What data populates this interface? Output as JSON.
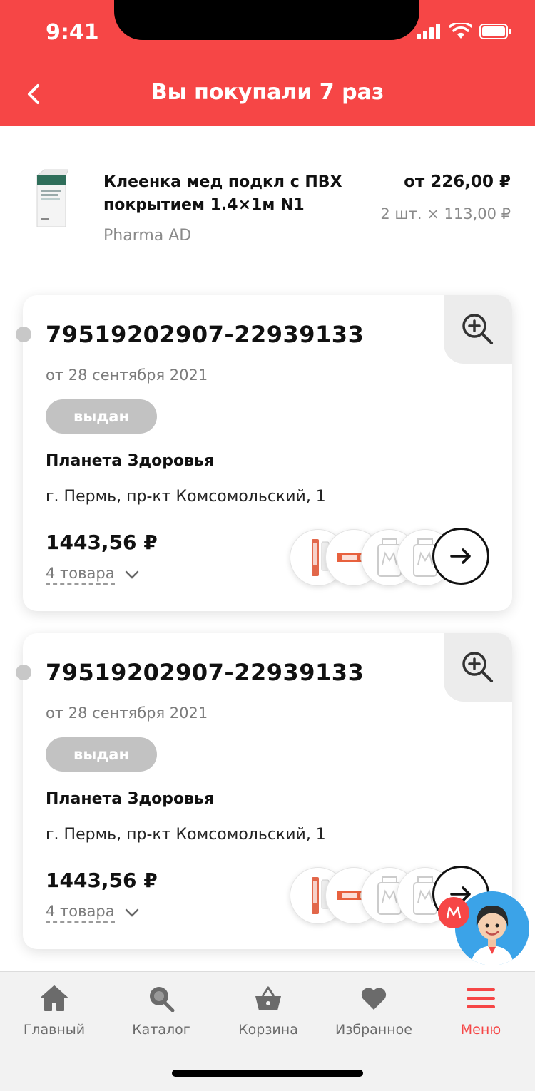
{
  "status_bar": {
    "time": "9:41"
  },
  "header": {
    "title": "Вы покупали 7 раз"
  },
  "product": {
    "name": "Клеенка мед подкл с ПВХ покрытием 1.4×1м N1",
    "brand": "Pharma AD",
    "price": "от 226,00 ₽",
    "quantity": "2 шт. × 113,00 ₽"
  },
  "orders": [
    {
      "number": "79519202907-22939133",
      "date": "от 28 сентября 2021",
      "status": "выдан",
      "store": "Планета Здоровья",
      "address": "г. Пермь, пр-кт Комсомольский, 1",
      "total": "1443,56 ₽",
      "items_count": "4 товара"
    },
    {
      "number": "79519202907-22939133",
      "date": "от 28 сентября 2021",
      "status": "выдан",
      "store": "Планета Здоровья",
      "address": "г. Пермь, пр-кт Комсомольский, 1",
      "total": "1443,56 ₽",
      "items_count": "4 товара"
    }
  ],
  "tabbar": {
    "items": [
      {
        "label": "Главный",
        "icon": "home-icon"
      },
      {
        "label": "Каталог",
        "icon": "search-icon"
      },
      {
        "label": "Корзина",
        "icon": "basket-icon"
      },
      {
        "label": "Избранное",
        "icon": "heart-icon"
      },
      {
        "label": "Меню",
        "icon": "menu-icon",
        "active": true
      }
    ]
  },
  "colors": {
    "accent": "#f64646",
    "badge": "#c2c2c2",
    "tab_inactive": "#6b6b6b"
  }
}
